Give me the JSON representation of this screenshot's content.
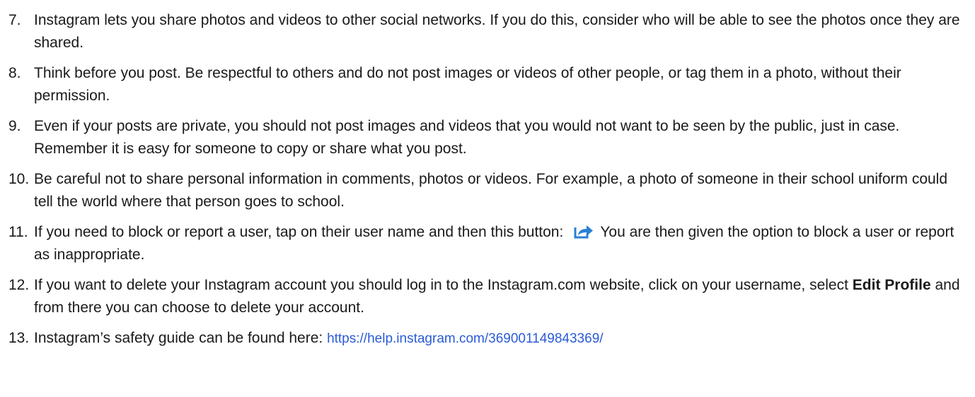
{
  "items": [
    {
      "number": "7.",
      "text": "Instagram lets you share photos and videos to other social networks. If you do this, consider who will be able to see the photos once they are shared."
    },
    {
      "number": "8.",
      "text": "Think before you post. Be respectful to others and do not post images or videos of other people, or tag them in a photo, without their permission."
    },
    {
      "number": "9.",
      "text": "Even if your posts are private, you should not post images and videos that you would not want to be seen by the public, just in case. Remember it is easy for someone to copy or share what you post."
    },
    {
      "number": "10.",
      "text": "Be careful not to share personal information in comments, photos or videos. For example, a photo of someone in their school uniform could tell the world where that person goes to school."
    },
    {
      "number": "11.",
      "text_before": "If you need to block or report a user, tap on their user name and then this button:",
      "icon": "share-arrow-icon",
      "text_after": "You are then given the option to block a user or report as inappropriate."
    },
    {
      "number": "12.",
      "text_before": "If you want to delete your Instagram account you should log in to the Instagram.com website, click on your username, select",
      "bold": "Edit Profile",
      "text_after": "and from there you can choose to delete your account."
    },
    {
      "number": "13.",
      "text": "Instagram’s safety guide can be found here:",
      "link": "https://help.instagram.com/369001149843369/"
    }
  ],
  "colors": {
    "text": "#1a1a1a",
    "link": "#2a5bd7",
    "icon": "#2a7fd4"
  }
}
